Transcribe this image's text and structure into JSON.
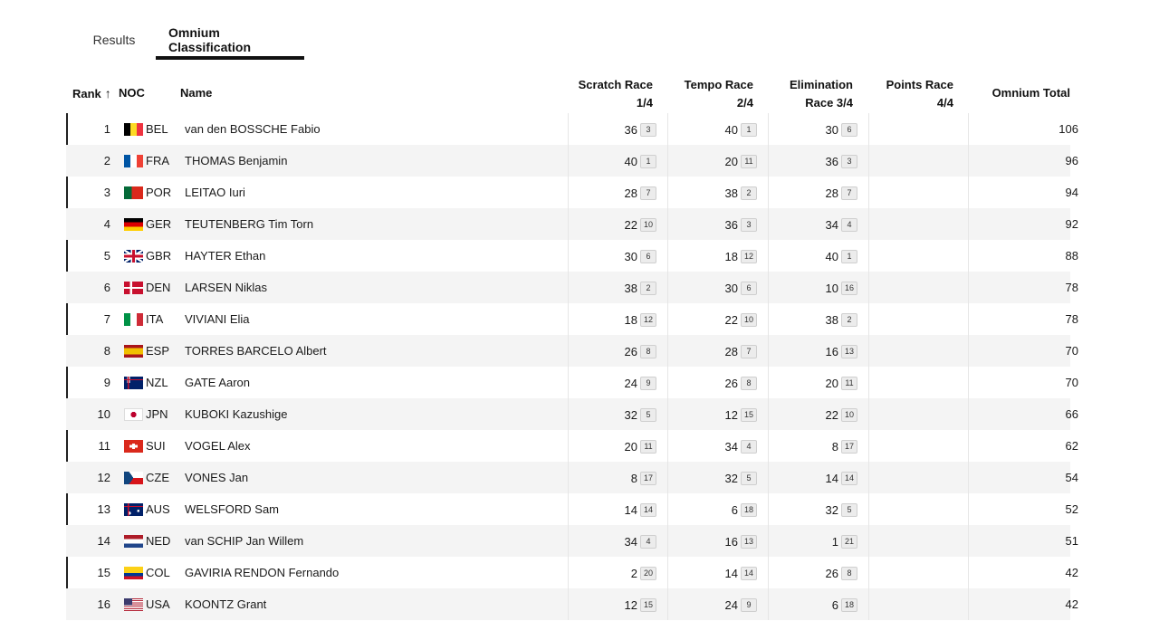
{
  "tabs": [
    {
      "label": "Results",
      "active": false
    },
    {
      "label": "Omnium Classification",
      "active": true
    }
  ],
  "columns": {
    "rank": "Rank",
    "sort_arrow": "↑",
    "noc": "NOC",
    "name": "Name",
    "scratch_l1": "Scratch Race",
    "scratch_l2": "1/4",
    "tempo_l1": "Tempo Race",
    "tempo_l2": "2/4",
    "elim_l1": "Elimination",
    "elim_l2": "Race 3/4",
    "points_l1": "Points Race",
    "points_l2": "4/4",
    "total": "Omnium Total"
  },
  "rows": [
    {
      "rank": "1",
      "noc": "BEL",
      "name": "van den BOSSCHE Fabio",
      "scratch": "36",
      "scratch_pos": "3",
      "tempo": "40",
      "tempo_pos": "1",
      "elim": "30",
      "elim_pos": "6",
      "total": "106"
    },
    {
      "rank": "2",
      "noc": "FRA",
      "name": "THOMAS Benjamin",
      "scratch": "40",
      "scratch_pos": "1",
      "tempo": "20",
      "tempo_pos": "11",
      "elim": "36",
      "elim_pos": "3",
      "total": "96"
    },
    {
      "rank": "3",
      "noc": "POR",
      "name": "LEITAO Iuri",
      "scratch": "28",
      "scratch_pos": "7",
      "tempo": "38",
      "tempo_pos": "2",
      "elim": "28",
      "elim_pos": "7",
      "total": "94"
    },
    {
      "rank": "4",
      "noc": "GER",
      "name": "TEUTENBERG Tim Torn",
      "scratch": "22",
      "scratch_pos": "10",
      "tempo": "36",
      "tempo_pos": "3",
      "elim": "34",
      "elim_pos": "4",
      "total": "92"
    },
    {
      "rank": "5",
      "noc": "GBR",
      "name": "HAYTER Ethan",
      "scratch": "30",
      "scratch_pos": "6",
      "tempo": "18",
      "tempo_pos": "12",
      "elim": "40",
      "elim_pos": "1",
      "total": "88"
    },
    {
      "rank": "6",
      "noc": "DEN",
      "name": "LARSEN Niklas",
      "scratch": "38",
      "scratch_pos": "2",
      "tempo": "30",
      "tempo_pos": "6",
      "elim": "10",
      "elim_pos": "16",
      "total": "78"
    },
    {
      "rank": "7",
      "noc": "ITA",
      "name": "VIVIANI Elia",
      "scratch": "18",
      "scratch_pos": "12",
      "tempo": "22",
      "tempo_pos": "10",
      "elim": "38",
      "elim_pos": "2",
      "total": "78"
    },
    {
      "rank": "8",
      "noc": "ESP",
      "name": "TORRES BARCELO Albert",
      "scratch": "26",
      "scratch_pos": "8",
      "tempo": "28",
      "tempo_pos": "7",
      "elim": "16",
      "elim_pos": "13",
      "total": "70"
    },
    {
      "rank": "9",
      "noc": "NZL",
      "name": "GATE Aaron",
      "scratch": "24",
      "scratch_pos": "9",
      "tempo": "26",
      "tempo_pos": "8",
      "elim": "20",
      "elim_pos": "11",
      "total": "70"
    },
    {
      "rank": "10",
      "noc": "JPN",
      "name": "KUBOKI Kazushige",
      "scratch": "32",
      "scratch_pos": "5",
      "tempo": "12",
      "tempo_pos": "15",
      "elim": "22",
      "elim_pos": "10",
      "total": "66"
    },
    {
      "rank": "11",
      "noc": "SUI",
      "name": "VOGEL Alex",
      "scratch": "20",
      "scratch_pos": "11",
      "tempo": "34",
      "tempo_pos": "4",
      "elim": "8",
      "elim_pos": "17",
      "total": "62"
    },
    {
      "rank": "12",
      "noc": "CZE",
      "name": "VONES Jan",
      "scratch": "8",
      "scratch_pos": "17",
      "tempo": "32",
      "tempo_pos": "5",
      "elim": "14",
      "elim_pos": "14",
      "total": "54"
    },
    {
      "rank": "13",
      "noc": "AUS",
      "name": "WELSFORD Sam",
      "scratch": "14",
      "scratch_pos": "14",
      "tempo": "6",
      "tempo_pos": "18",
      "elim": "32",
      "elim_pos": "5",
      "total": "52"
    },
    {
      "rank": "14",
      "noc": "NED",
      "name": "van SCHIP Jan Willem",
      "scratch": "34",
      "scratch_pos": "4",
      "tempo": "16",
      "tempo_pos": "13",
      "elim": "1",
      "elim_pos": "21",
      "total": "51"
    },
    {
      "rank": "15",
      "noc": "COL",
      "name": "GAVIRIA RENDON Fernando",
      "scratch": "2",
      "scratch_pos": "20",
      "tempo": "14",
      "tempo_pos": "14",
      "elim": "26",
      "elim_pos": "8",
      "total": "42"
    },
    {
      "rank": "16",
      "noc": "USA",
      "name": "KOONTZ Grant",
      "scratch": "12",
      "scratch_pos": "15",
      "tempo": "24",
      "tempo_pos": "9",
      "elim": "6",
      "elim_pos": "18",
      "total": "42"
    }
  ]
}
